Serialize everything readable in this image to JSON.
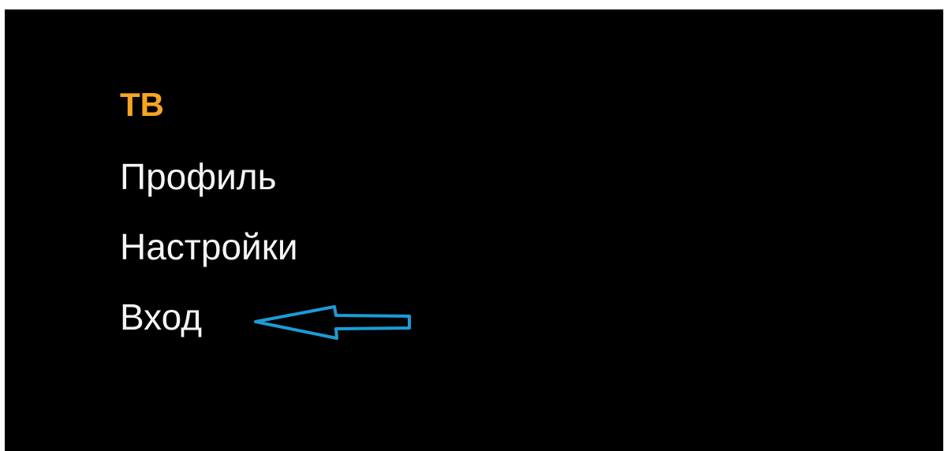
{
  "theme": {
    "background": "#000000",
    "text_color": "#f5f5f5",
    "active_color": "#f5a623",
    "annotation_color": "#1e9ad6"
  },
  "menu": {
    "items": [
      {
        "label": "ТВ",
        "active": true
      },
      {
        "label": "Профиль",
        "active": false
      },
      {
        "label": "Настройки",
        "active": false
      },
      {
        "label": "Вход",
        "active": false
      }
    ]
  },
  "annotation": {
    "icon": "left-arrow-icon",
    "points_to": "Вход"
  }
}
